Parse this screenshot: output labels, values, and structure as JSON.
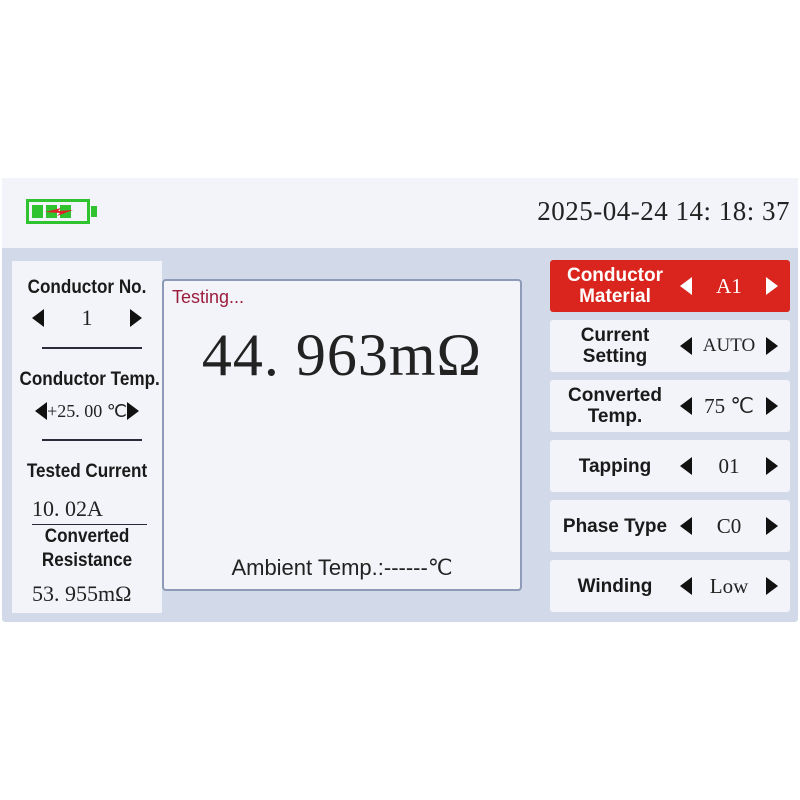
{
  "header": {
    "datetime": "2025-04-24 14: 18: 37",
    "battery_icon": "battery-charging-icon",
    "battery_color": "#2fc42f"
  },
  "left": {
    "conductor_no_label": "Conductor No.",
    "conductor_no_value": "1",
    "conductor_temp_label": "Conductor Temp.",
    "conductor_temp_value": "+25. 00 ℃",
    "tested_current_label": "Tested Current",
    "tested_current_value": "10. 02A",
    "converted_resistance_label_1": "Converted",
    "converted_resistance_label_2": "Resistance",
    "converted_resistance_value": "53. 955mΩ"
  },
  "center": {
    "status": "Testing...",
    "reading": "44. 963mΩ",
    "ambient": "Ambient Temp.:------℃"
  },
  "settings": [
    {
      "label_1": "Conductor",
      "label_2": "Material",
      "value": "A1",
      "active": true
    },
    {
      "label_1": "Current",
      "label_2": "Setting",
      "value": "AUTO",
      "active": false
    },
    {
      "label_1": "Converted",
      "label_2": "Temp.",
      "value": "75 ℃",
      "active": false
    },
    {
      "label_1": "Tapping",
      "label_2": "",
      "value": "01",
      "active": false
    },
    {
      "label_1": "Phase Type",
      "label_2": "",
      "value": "C0",
      "active": false
    },
    {
      "label_1": "Winding",
      "label_2": "",
      "value": "Low",
      "active": false
    }
  ],
  "colors": {
    "active_accent": "#d9251d",
    "status_text": "#9c1c3c",
    "screen_bg": "#d2d9e9"
  }
}
